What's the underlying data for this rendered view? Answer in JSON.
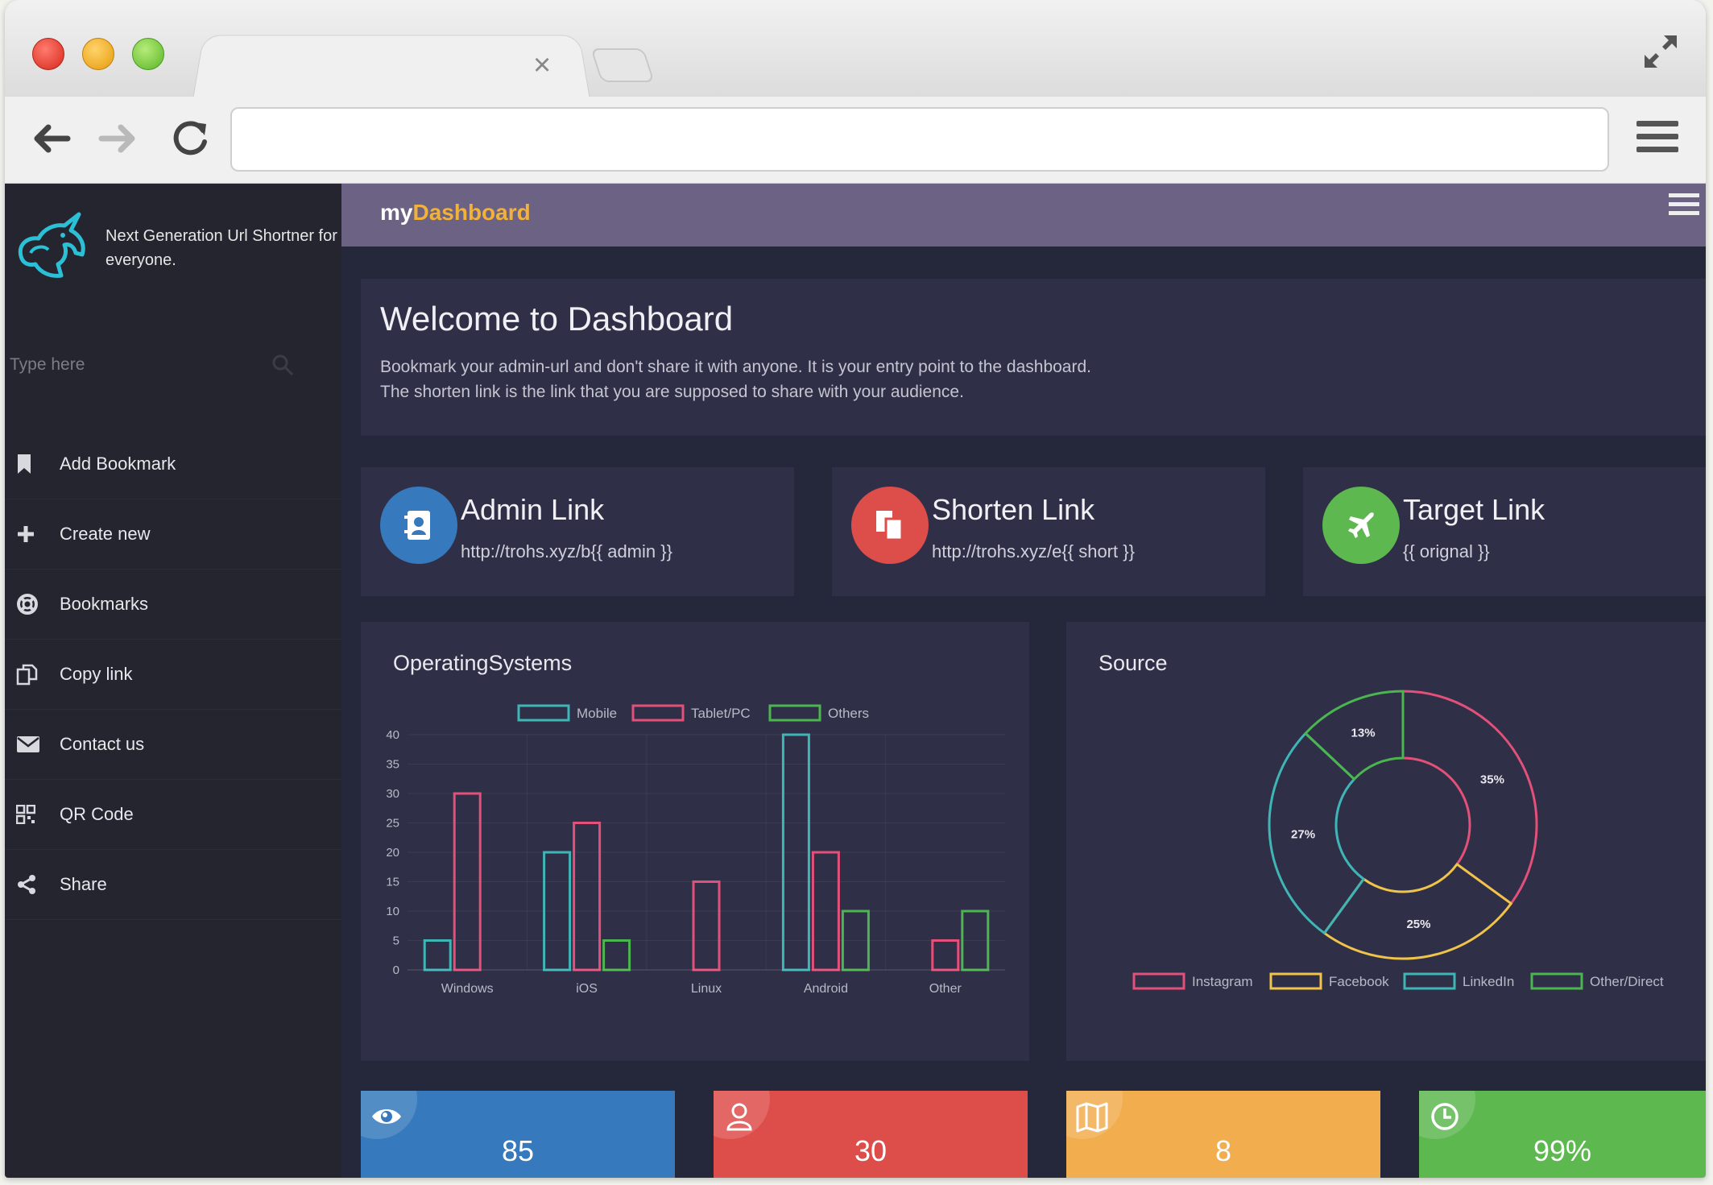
{
  "colors": {
    "blue": "#3679bd",
    "red": "#dd4d4a",
    "green": "#5db850",
    "orange": "#f2ad4e",
    "accent": "#f2b13b",
    "pink": "#e3507a",
    "teal": "#3fb6b6",
    "yellow": "#f0c34a",
    "lime": "#4bb54f"
  },
  "browser": {
    "tab_close_icon": "close-icon",
    "expand_icon": "expand-icon",
    "url": ""
  },
  "sidebar": {
    "brand": "Next Generation Url Shortner for everyone.",
    "search_placeholder": "Type here",
    "items": [
      {
        "label": "Add Bookmark",
        "icon": "bookmark-icon"
      },
      {
        "label": "Create new",
        "icon": "plus-icon"
      },
      {
        "label": "Bookmarks",
        "icon": "lifebuoy-icon"
      },
      {
        "label": "Copy link",
        "icon": "copy-icon"
      },
      {
        "label": "Contact us",
        "icon": "envelope-icon"
      },
      {
        "label": "QR Code",
        "icon": "qrcode-icon"
      },
      {
        "label": "Share",
        "icon": "share-icon"
      }
    ]
  },
  "topbar": {
    "title_prefix": "my",
    "title_highlight": "Dashboard"
  },
  "welcome": {
    "title": "Welcome to Dashboard",
    "line1": "Bookmark your admin-url and don't share it with anyone. It is your entry point to the dashboard.",
    "line2": "The shorten link is the link that you are supposed to share with your audience."
  },
  "cards": [
    {
      "title": "Admin Link",
      "sub": "http://trohs.xyz/b{{ admin }}",
      "icon": "contact-book-icon"
    },
    {
      "title": "Shorten Link",
      "sub": "http://trohs.xyz/e{{ short }}",
      "icon": "copy-files-icon"
    },
    {
      "title": "Target Link",
      "sub": "{{ orignal }}",
      "icon": "plane-icon"
    }
  ],
  "os_panel": {
    "title": "OperatingSystems"
  },
  "source_panel": {
    "title": "Source"
  },
  "stats": [
    {
      "value": "85",
      "icon": "eye-icon"
    },
    {
      "value": "30",
      "icon": "user-icon"
    },
    {
      "value": "8",
      "icon": "map-icon"
    },
    {
      "value": "99%",
      "icon": "clock-icon"
    }
  ],
  "chart_data": [
    {
      "type": "bar",
      "title": "OperatingSystems",
      "categories": [
        "Windows",
        "iOS",
        "Linux",
        "Android",
        "Other"
      ],
      "series": [
        {
          "name": "Mobile",
          "values": [
            5,
            20,
            0,
            40,
            0
          ]
        },
        {
          "name": "Tablet/PC",
          "values": [
            30,
            25,
            15,
            20,
            5
          ]
        },
        {
          "name": "Others",
          "values": [
            0,
            5,
            0,
            10,
            10
          ]
        }
      ],
      "ylim": [
        0,
        40
      ],
      "yticks": [
        0,
        5,
        10,
        15,
        20,
        25,
        30,
        35,
        40
      ],
      "legend": "top",
      "grid": true
    },
    {
      "type": "pie",
      "title": "Source",
      "labels": [
        "Instagram",
        "Facebook",
        "LinkedIn",
        "Other/Direct"
      ],
      "values": [
        35,
        25,
        27,
        13
      ],
      "value_labels": [
        "35%",
        "25%",
        "27%",
        "13%"
      ],
      "legend": "bottom"
    }
  ]
}
